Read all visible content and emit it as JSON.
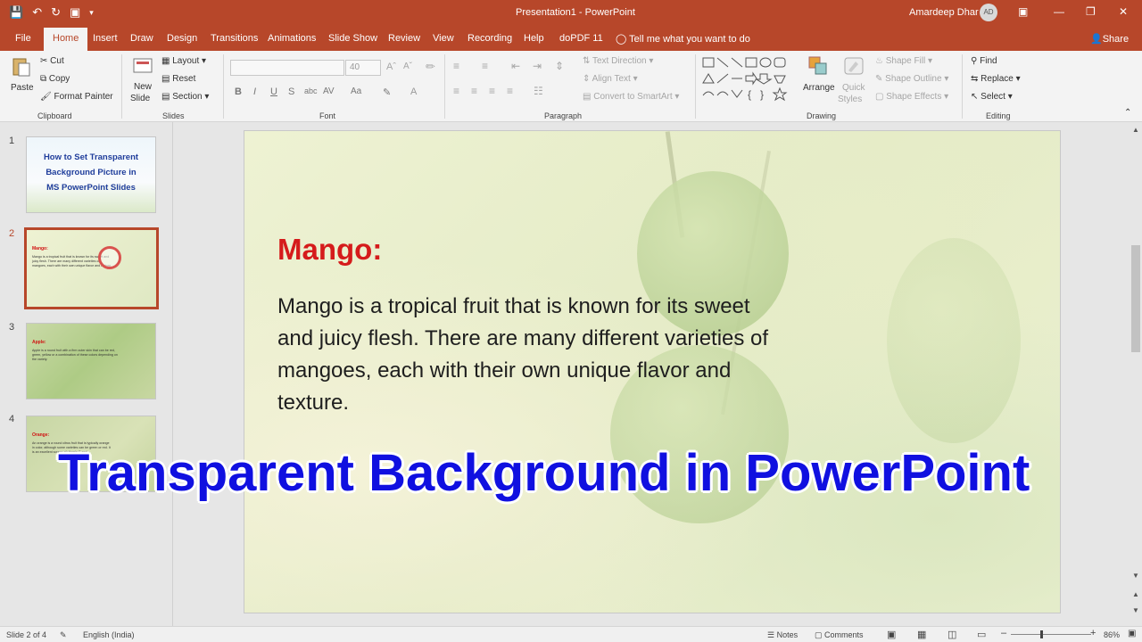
{
  "window": {
    "doc_title": "Presentation1  -  PowerPoint",
    "user_name": "Amardeep Dhar",
    "user_initials": "AD"
  },
  "tabs": [
    "File",
    "Home",
    "Insert",
    "Draw",
    "Design",
    "Transitions",
    "Animations",
    "Slide Show",
    "Review",
    "View",
    "Recording",
    "Help",
    "doPDF 11"
  ],
  "tell_me": "Tell me what you want to do",
  "share": "Share",
  "ribbon": {
    "clipboard": {
      "paste": "Paste",
      "cut": "Cut",
      "copy": "Copy",
      "format_painter": "Format Painter",
      "label": "Clipboard"
    },
    "slides": {
      "new_slide_1": "New",
      "new_slide_2": "Slide",
      "layout": "Layout",
      "reset": "Reset",
      "section": "Section",
      "label": "Slides"
    },
    "font": {
      "size": "40",
      "label": "Font"
    },
    "paragraph": {
      "text_direction": "Text Direction",
      "align_text": "Align Text",
      "convert_smartart": "Convert to SmartArt",
      "label": "Paragraph"
    },
    "drawing": {
      "arrange": "Arrange",
      "quick_styles_1": "Quick",
      "quick_styles_2": "Styles",
      "shape_fill": "Shape Fill",
      "shape_outline": "Shape Outline",
      "shape_effects": "Shape Effects",
      "label": "Drawing"
    },
    "editing": {
      "find": "Find",
      "replace": "Replace",
      "select": "Select",
      "label": "Editing"
    }
  },
  "thumbnails": [
    {
      "num": "1",
      "title": "How to Set Transparent Background Picture in MS PowerPoint Slides"
    },
    {
      "num": "2",
      "title": "Mango:",
      "body": "Mango is a tropical fruit that is known for its sweet and juicy flesh. There are many different varieties of mangoes, each with their own unique flavor and texture."
    },
    {
      "num": "3",
      "title": "Apple:",
      "body": "Apple is a round fruit with a firm outer skin that can be red, green, yellow or a combination of these colors depending on the variety."
    },
    {
      "num": "4",
      "title": "Orange:",
      "body": "An orange is a round citrus fruit that is typically orange in color, although some varieties can be green or red. It is an excellent source of vitamin C and..."
    }
  ],
  "slide": {
    "title": "Mango:",
    "body": "Mango is a tropical fruit that is known for its sweet and juicy flesh. There are many different varieties of mangoes, each with their own unique flavor and texture."
  },
  "banner": "Transparent Background in PowerPoint",
  "status": {
    "slide_of": "Slide 2 of 4",
    "language": "English (India)",
    "notes": "Notes",
    "comments": "Comments",
    "zoom": "86%"
  },
  "colors": {
    "accent": "#b7472a",
    "slide_title": "#d51b1b",
    "banner": "#1010e0"
  }
}
